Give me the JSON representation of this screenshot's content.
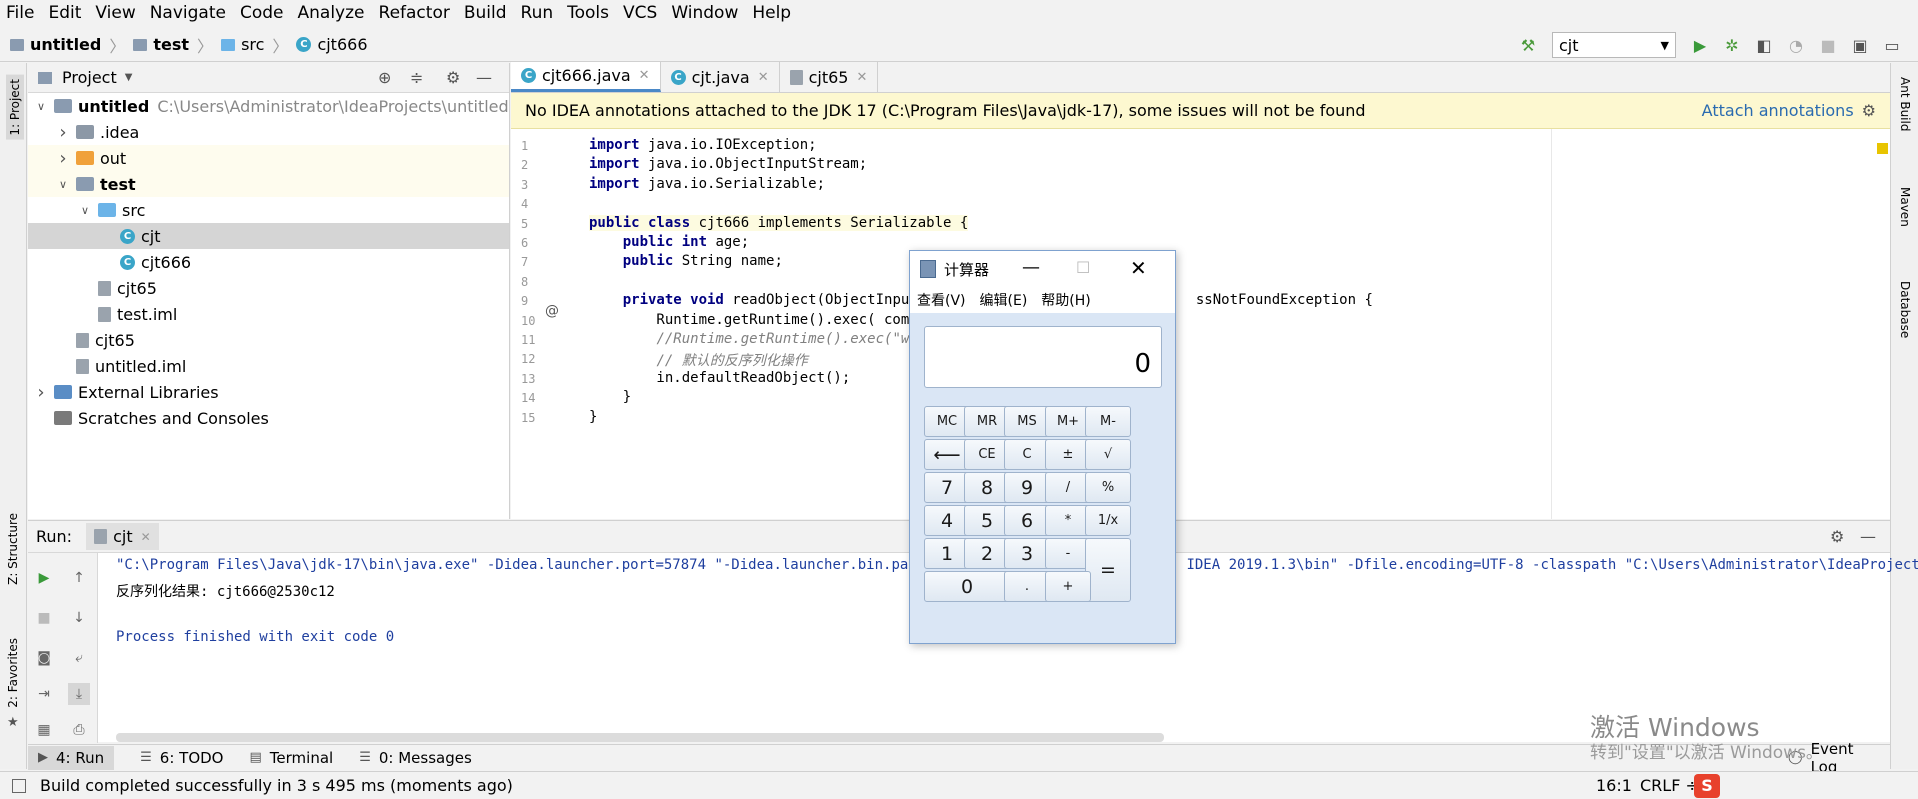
{
  "menu": [
    "File",
    "Edit",
    "View",
    "Navigate",
    "Code",
    "Analyze",
    "Refactor",
    "Build",
    "Run",
    "Tools",
    "VCS",
    "Window",
    "Help"
  ],
  "breadcrumb": [
    "untitled",
    "test",
    "src",
    "cjt666"
  ],
  "run_config": "cjt",
  "left_strip": {
    "project": "1: Project",
    "structure": "Z: Structure",
    "favorites": "2: Favorites"
  },
  "right_strip": {
    "ant": "Ant Build",
    "maven": "Maven",
    "database": "Database"
  },
  "project_panel": {
    "title": "Project",
    "tree": [
      {
        "label": "untitled",
        "path": "C:\\Users\\Administrator\\IdeaProjects\\untitled",
        "indent": 0,
        "arrow": "v",
        "type": "module"
      },
      {
        "label": ".idea",
        "indent": 1,
        "arrow": ">",
        "type": "folder-grey"
      },
      {
        "label": "out",
        "indent": 1,
        "arrow": ">",
        "type": "folder-orange"
      },
      {
        "label": "test",
        "indent": 1,
        "arrow": "v",
        "type": "module"
      },
      {
        "label": "src",
        "indent": 2,
        "arrow": "v",
        "type": "folder-blue"
      },
      {
        "label": "cjt",
        "indent": 3,
        "arrow": "",
        "type": "class"
      },
      {
        "label": "cjt666",
        "indent": 3,
        "arrow": "",
        "type": "class"
      },
      {
        "label": "cjt65",
        "indent": 2,
        "arrow": "",
        "type": "file"
      },
      {
        "label": "test.iml",
        "indent": 2,
        "arrow": "",
        "type": "file"
      },
      {
        "label": "cjt65",
        "indent": 1,
        "arrow": "",
        "type": "file"
      },
      {
        "label": "untitled.iml",
        "indent": 1,
        "arrow": "",
        "type": "file"
      },
      {
        "label": "External Libraries",
        "indent": 0,
        "arrow": ">",
        "type": "lib"
      },
      {
        "label": "Scratches and Consoles",
        "indent": 0,
        "arrow": "",
        "type": "scratch"
      }
    ]
  },
  "tabs": [
    "cjt666.java",
    "cjt.java",
    "cjt65"
  ],
  "banner": {
    "text": "No IDEA annotations attached to the JDK 17 (C:\\Program Files\\Java\\jdk-17), some issues will not be found",
    "link": "Attach annotations"
  },
  "code_lines": [
    {
      "n": "1",
      "pre": "",
      "kw": "import",
      "rest": " java.io.IOException;"
    },
    {
      "n": "2",
      "pre": "",
      "kw": "import",
      "rest": " java.io.ObjectInputStream;"
    },
    {
      "n": "3",
      "pre": "",
      "kw": "import",
      "rest": " java.io.Serializable;"
    },
    {
      "n": "4",
      "pre": "",
      "kw": "",
      "rest": ""
    },
    {
      "n": "5",
      "pre": "",
      "kw": "public class",
      "rest": " cjt666 implements Serializable {"
    },
    {
      "n": "6",
      "pre": "    ",
      "kw": "public int",
      "rest": " age;"
    },
    {
      "n": "7",
      "pre": "    ",
      "kw": "public",
      "rest": " String name;"
    },
    {
      "n": "8",
      "pre": "",
      "kw": "",
      "rest": ""
    },
    {
      "n": "9",
      "pre": "    ",
      "kw": "private void",
      "rest": " readObject(ObjectInputS                                ssNotFoundException {"
    },
    {
      "n": "10",
      "pre": "        ",
      "kw": "",
      "rest": "Runtime.getRuntime().exec( comm"
    },
    {
      "n": "11",
      "pre": "        ",
      "kw": "",
      "rest": "//Runtime.getRuntime().exec(\"who",
      "comment": true
    },
    {
      "n": "12",
      "pre": "        ",
      "kw": "",
      "rest": "// 默认的反序列化操作",
      "comment": true
    },
    {
      "n": "13",
      "pre": "        ",
      "kw": "",
      "rest": "in.defaultReadObject();"
    },
    {
      "n": "14",
      "pre": "    ",
      "kw": "",
      "rest": "}"
    },
    {
      "n": "15",
      "pre": "",
      "kw": "",
      "rest": "}"
    }
  ],
  "run": {
    "label": "Run:",
    "tab": "cjt",
    "lines": [
      "\"C:\\Program Files\\Java\\jdk-17\\bin\\java.exe\" -Didea.launcher.port=57874 \"-Didea.launcher.bin.path=C:                            IDEA 2019.1.3\\bin\" -Dfile.encoding=UTF-8 -classpath \"C:\\Users\\Administrator\\IdeaProjects\\",
      "反序列化结果: cjt666@2530c12",
      "",
      "Process finished with exit code 0"
    ]
  },
  "bottom_tabs": [
    "4: Run",
    "6: TODO",
    "Terminal",
    "0: Messages"
  ],
  "event_log": "Event Log",
  "status": {
    "message": "Build completed successfully in 3 s 495 ms (moments ago)",
    "pos": "16:1",
    "sep": "CRLF ÷"
  },
  "calculator": {
    "title": "计算器",
    "menu": [
      "查看(V)",
      "编辑(E)",
      "帮助(H)"
    ],
    "display": "0",
    "buttons": [
      "MC",
      "MR",
      "MS",
      "M+",
      "M-",
      "⟵",
      "CE",
      "C",
      "±",
      "√",
      "7",
      "8",
      "9",
      "/",
      "%",
      "4",
      "5",
      "6",
      "*",
      "1/x",
      "1",
      "2",
      "3",
      "-",
      "=",
      "0",
      ".",
      "+"
    ]
  },
  "watermark": {
    "line1": "激活 Windows",
    "line2": "转到\"设置\"以激活 Windows。"
  }
}
